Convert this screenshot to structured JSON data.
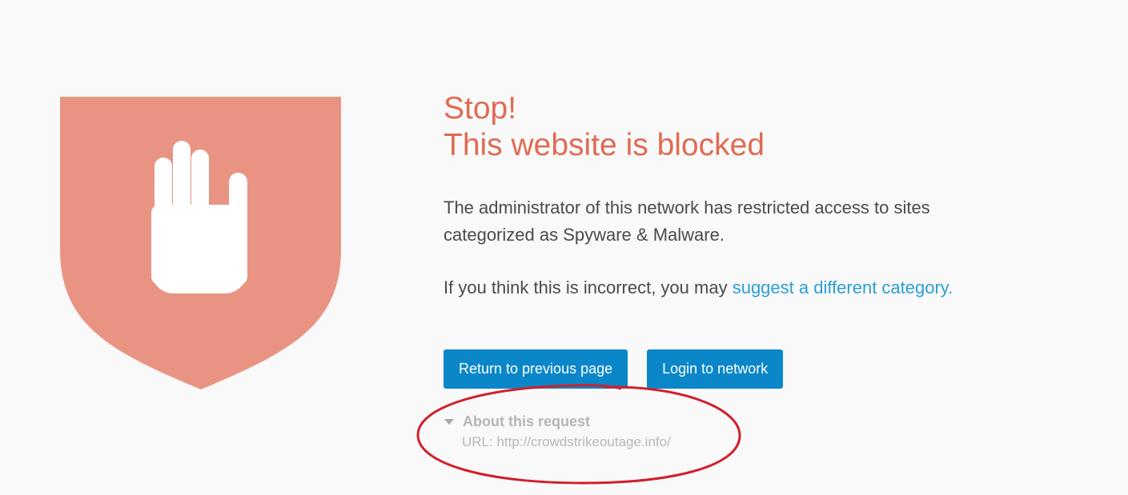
{
  "title": {
    "line1": "Stop!",
    "line2": "This website is blocked"
  },
  "description": "The administrator of this network has restricted access to sites categorized as Spyware & Malware.",
  "suggest": {
    "prefix": "If you think this is incorrect, you may ",
    "link_text": "suggest a different category."
  },
  "buttons": {
    "return": "Return to previous page",
    "login": "Login to network"
  },
  "about": {
    "heading": "About this request",
    "url_line": "URL: http://crowdstrikeoutage.info/"
  },
  "icons": {
    "shield": "shield-icon",
    "hand": "stop-hand-icon",
    "caret": "caret-down-icon"
  },
  "colors": {
    "background": "#f9f9f9",
    "shield": "#e99483",
    "title": "#e06b52",
    "link": "#2a9fd6",
    "button": "#0a86c9",
    "annotation": "#d11f2a"
  }
}
